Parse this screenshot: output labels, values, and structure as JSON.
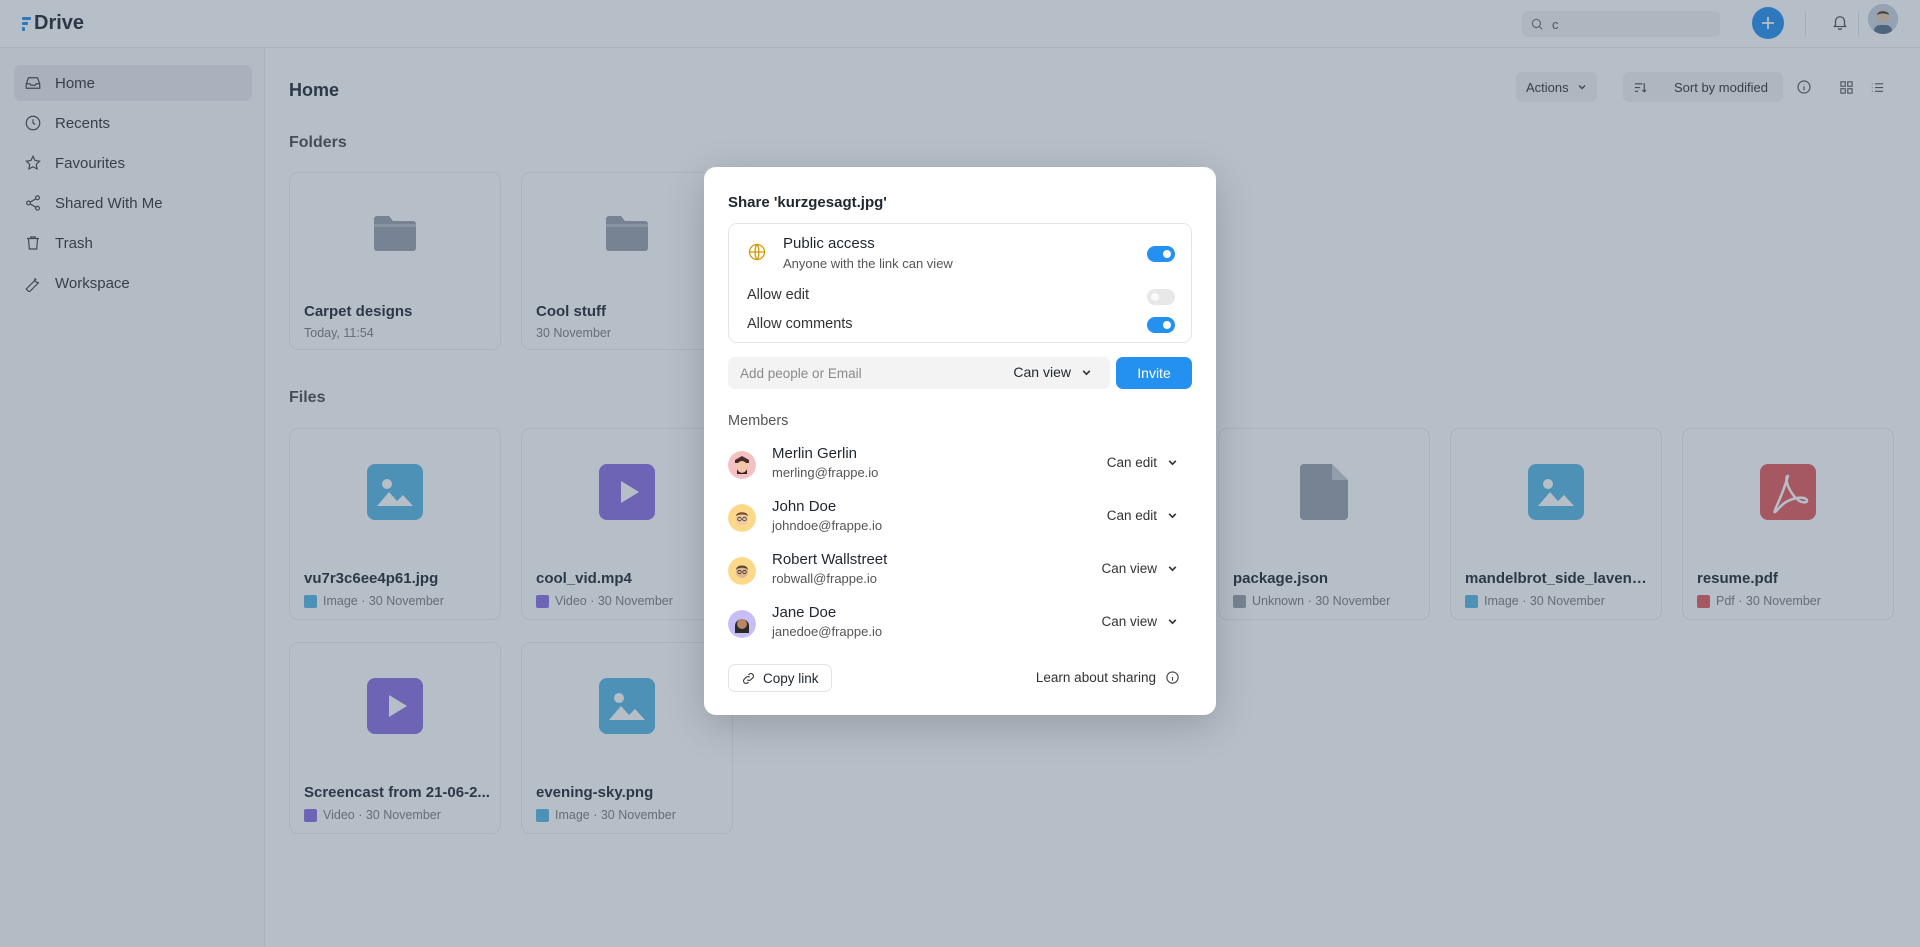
{
  "app": {
    "name": "Drive",
    "search_value": "c"
  },
  "sidebar": {
    "items": [
      {
        "label": "Home",
        "icon": "inbox-icon",
        "active": true
      },
      {
        "label": "Recents",
        "icon": "clock-icon"
      },
      {
        "label": "Favourites",
        "icon": "star-icon"
      },
      {
        "label": "Shared With Me",
        "icon": "share-icon"
      },
      {
        "label": "Trash",
        "icon": "trash-icon"
      },
      {
        "label": "Workspace",
        "icon": "wrench-icon"
      }
    ]
  },
  "main": {
    "title": "Home",
    "actions_label": "Actions",
    "sort_label": "Sort by modified",
    "folders_title": "Folders",
    "files_title": "Files",
    "folders": [
      {
        "name": "Carpet designs",
        "meta": "Today, 11:54"
      },
      {
        "name": "Cool stuff",
        "meta": "30 November"
      }
    ],
    "files": [
      {
        "name": "vu7r3c6ee4p61.jpg",
        "meta": "Image · 30 November",
        "kind": "image"
      },
      {
        "name": "cool_vid.mp4",
        "meta": "Video · 30 November",
        "kind": "video"
      },
      {
        "name": "package.json",
        "meta": "Unknown · 30 November",
        "kind": "unknown"
      },
      {
        "name": "mandelbrot_side_lavende...",
        "meta": "Image · 30 November",
        "kind": "image"
      },
      {
        "name": "resume.pdf",
        "meta": "Pdf · 30 November",
        "kind": "pdf"
      },
      {
        "name": "Screencast from 21-06-2...",
        "meta": "Video · 30 November",
        "kind": "video"
      },
      {
        "name": "evening-sky.png",
        "meta": "Image · 30 November",
        "kind": "image"
      }
    ]
  },
  "dialog": {
    "title": "Share 'kurzgesagt.jpg'",
    "public_access": {
      "title": "Public access",
      "subtitle": "Anyone with the link can view",
      "enabled": true
    },
    "allow_edit": {
      "label": "Allow edit",
      "enabled": false
    },
    "allow_comments": {
      "label": "Allow comments",
      "enabled": true
    },
    "invite": {
      "placeholder": "Add people or Email",
      "permission": "Can view",
      "button": "Invite"
    },
    "members_label": "Members",
    "members": [
      {
        "name": "Merlin Gerlin",
        "email": "merling@frappe.io",
        "permission": "Can edit"
      },
      {
        "name": "John Doe",
        "email": "johndoe@frappe.io",
        "permission": "Can edit"
      },
      {
        "name": "Robert Wallstreet",
        "email": "robwall@frappe.io",
        "permission": "Can view"
      },
      {
        "name": "Jane Doe",
        "email": "janedoe@frappe.io",
        "permission": "Can view"
      }
    ],
    "copy_link": "Copy link",
    "learn_sharing": "Learn about sharing"
  },
  "colors": {
    "accent": "#2490ef",
    "image": "#57b6e4",
    "video": "#8a6fe0",
    "pdf": "#e55b5b",
    "folder": "#9aa0a8"
  }
}
